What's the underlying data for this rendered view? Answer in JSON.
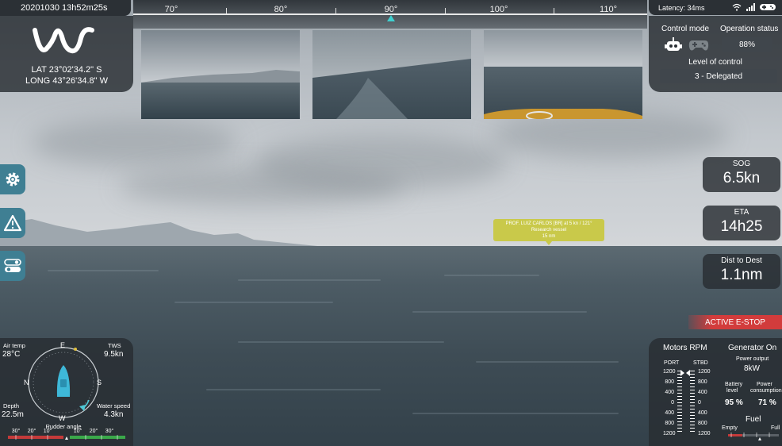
{
  "header": {
    "datetime": "20201030 13h52m25s",
    "latency": "Latency: 34ms"
  },
  "heading": {
    "labels": [
      "70°",
      "80°",
      "90°",
      "100°",
      "110°"
    ]
  },
  "position": {
    "lat": "LAT 23°02'34.2\" S",
    "long": "LONG 43°26'34.8\" W"
  },
  "control": {
    "mode_label": "Control mode",
    "status_label": "Operation status",
    "status_value": "88%",
    "level_label": "Level of control",
    "level_value": "3 - Delegated",
    "icons": [
      "robot-icon",
      "gamepad-icon"
    ]
  },
  "side_buttons": [
    "gear-icon",
    "warning-icon",
    "toggle-icon"
  ],
  "metrics": [
    {
      "label": "SOG",
      "value": "6.5kn"
    },
    {
      "label": "ETA",
      "value": "14h25"
    },
    {
      "label": "Dist to Dest",
      "value": "1.1nm"
    }
  ],
  "estop": "ACTIVE E-STOP",
  "ais": {
    "line1": "PROF. LUIZ CARLOS [BR] at 5 kn / 121°",
    "line2": "Research vessel",
    "line3": "15 nm"
  },
  "nav": {
    "air_temp_label": "Air temp",
    "air_temp": "28°C",
    "tws_label": "TWS",
    "tws": "9.5kn",
    "depth_label": "Depth",
    "depth": "22.5m",
    "water_speed_label": "Water speed",
    "water_speed": "4.3kn",
    "compass": {
      "e": "E",
      "n": "N",
      "s": "S",
      "w": "W"
    },
    "rudder_label": "Rudder angle",
    "rudder_ticks": [
      "30°",
      "20°",
      "10°",
      "10°",
      "20°",
      "30°"
    ]
  },
  "power": {
    "motors_label": "Motors RPM",
    "port_label": "PORT",
    "stbd_label": "STBD",
    "rpm_ticks": [
      "1200",
      "800",
      "400",
      "0",
      "400",
      "800",
      "1200"
    ],
    "generator_label": "Generator On",
    "power_output_label": "Power output",
    "power_output": "8kW",
    "battery_label_1": "Battery",
    "battery_label_2": "level",
    "battery": "95 %",
    "consumption_label_1": "Power",
    "consumption_label_2": "consumption",
    "consumption": "71 %",
    "fuel_label": "Fuel",
    "fuel_empty": "Empty",
    "fuel_full": "Full"
  },
  "colors": {
    "accent": "#3f7f93",
    "estop": "#d23c3c",
    "ais": "#c9c94a",
    "heading_marker": "#3fd0d0"
  }
}
